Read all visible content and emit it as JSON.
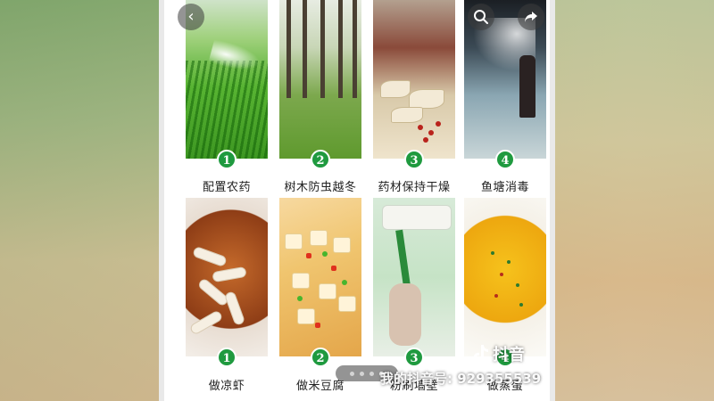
{
  "gallery": {
    "items": [
      {
        "number": "1",
        "caption": "配置农药"
      },
      {
        "number": "2",
        "caption": "树木防虫越冬"
      },
      {
        "number": "3",
        "caption": "药材保持干燥"
      },
      {
        "number": "4",
        "caption": "鱼塘消毒"
      },
      {
        "number": "1",
        "caption": "做凉虾"
      },
      {
        "number": "2",
        "caption": "做米豆腐"
      },
      {
        "number": "3",
        "caption": "粉刷墙壁"
      },
      {
        "number": "4",
        "caption": "做蒸蛋"
      }
    ]
  },
  "toolbar": {
    "back_icon": "back-arrow-icon",
    "search_icon": "search-icon",
    "share_icon": "share-icon"
  },
  "pager": {
    "count": 4,
    "active_index": 3
  },
  "watermark": {
    "app_name": "抖音",
    "account": "我的抖音号: 929355539"
  },
  "colors": {
    "badge": "#1f9a3f",
    "caption": "#222222"
  }
}
